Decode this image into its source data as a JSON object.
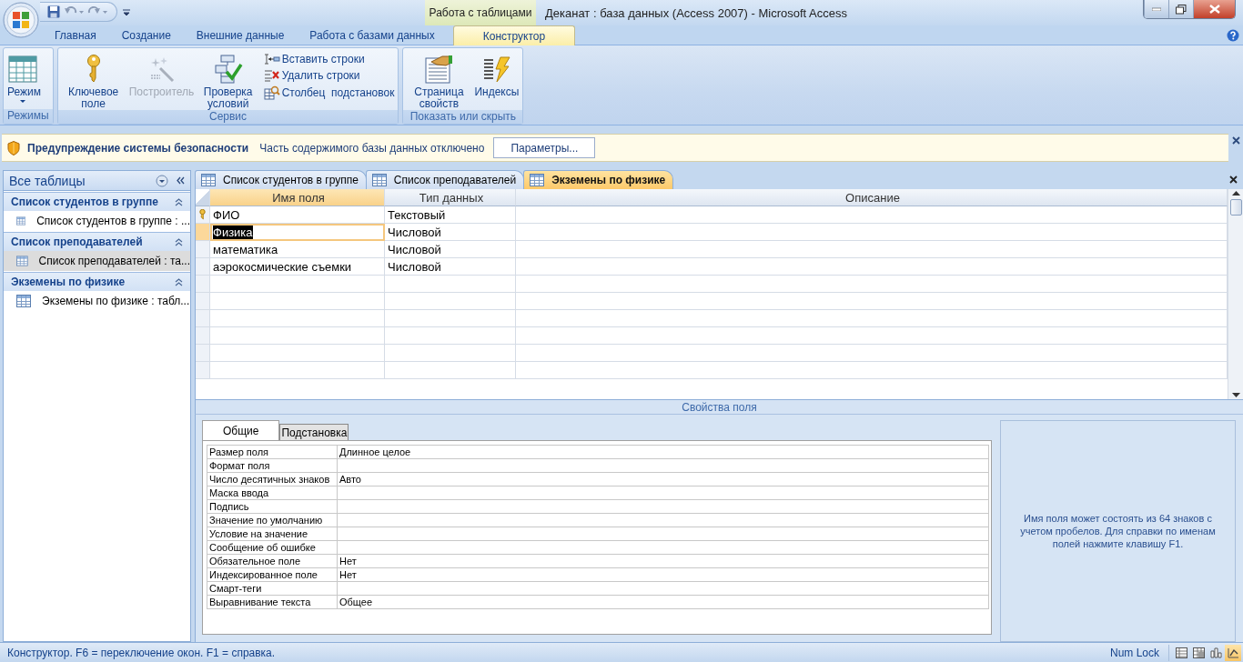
{
  "window": {
    "context_tab": "Работа с таблицами",
    "title": "Деканат : база данных (Access 2007)  -  Microsoft Access"
  },
  "ribbon": {
    "tabs": [
      {
        "label": "Главная",
        "selected": false
      },
      {
        "label": "Создание",
        "selected": false
      },
      {
        "label": "Внешние данные",
        "selected": false
      },
      {
        "label": "Работа с базами данных",
        "selected": false
      },
      {
        "label": "Конструктор",
        "selected": true
      }
    ],
    "groups": [
      {
        "label": "Режимы",
        "items": [
          {
            "kind": "large",
            "label": "Режим",
            "disabled": false
          }
        ]
      },
      {
        "label": "Сервис",
        "items": [
          {
            "kind": "large",
            "label": "Ключевое поле",
            "disabled": false
          },
          {
            "kind": "large",
            "label": "Построитель",
            "disabled": true
          },
          {
            "kind": "large",
            "label": "Проверка условий",
            "disabled": false
          },
          {
            "kind": "small",
            "label": "Вставить строки",
            "disabled": false
          },
          {
            "kind": "small",
            "label": "Удалить строки",
            "disabled": false
          },
          {
            "kind": "small",
            "label": "Столбец  подстановок",
            "disabled": false
          }
        ]
      },
      {
        "label": "Показать или скрыть",
        "items": [
          {
            "kind": "large",
            "label": "Страница свойств",
            "disabled": false
          },
          {
            "kind": "large",
            "label": "Индексы",
            "disabled": false
          }
        ]
      }
    ]
  },
  "security_bar": {
    "title": "Предупреждение системы безопасности",
    "message": "Часть содержимого базы данных отключено",
    "button": "Параметры..."
  },
  "navigation_pane": {
    "title": "Все таблицы",
    "groups": [
      {
        "label": "Список студентов в группе",
        "items": [
          {
            "label": "Список студентов в группе : ...",
            "selected": false
          }
        ]
      },
      {
        "label": "Список преподавателей",
        "items": [
          {
            "label": "Список преподавателей : та...",
            "selected": true
          }
        ]
      },
      {
        "label": "Экземены по физике",
        "items": [
          {
            "label": "Экземены по физике : табл...",
            "selected": false
          }
        ]
      }
    ]
  },
  "document_tabs": [
    {
      "label": "Список студентов в группе",
      "selected": false
    },
    {
      "label": "Список преподавателей",
      "selected": false
    },
    {
      "label": "Экземены по физике",
      "selected": true
    }
  ],
  "design_grid": {
    "columns": [
      "Имя поля",
      "Тип данных",
      "Описание"
    ],
    "rows": [
      {
        "name": "ФИО",
        "type": "Текстовый",
        "primary_key": true,
        "selected": false
      },
      {
        "name": "Физика",
        "type": "Числовой",
        "primary_key": false,
        "selected": true
      },
      {
        "name": "математика",
        "type": "Числовой",
        "primary_key": false,
        "selected": false
      },
      {
        "name": "аэрокосмические съемки",
        "type": "Числовой",
        "primary_key": false,
        "selected": false
      }
    ]
  },
  "field_properties": {
    "caption": "Свойства поля",
    "tabs": [
      {
        "label": "Общие",
        "selected": true
      },
      {
        "label": "Подстановка",
        "selected": false
      }
    ],
    "properties": [
      {
        "label": "Размер поля",
        "value": "Длинное целое"
      },
      {
        "label": "Формат поля"
      },
      {
        "label": "Число десятичных знаков",
        "value": "Авто"
      },
      {
        "label": "Маска ввода"
      },
      {
        "label": "Подпись"
      },
      {
        "label": "Значение по умолчанию"
      },
      {
        "label": "Условие на значение"
      },
      {
        "label": "Сообщение об ошибке"
      },
      {
        "label": "Обязательное поле",
        "value": "Нет"
      },
      {
        "label": "Индексированное поле",
        "value": "Нет"
      },
      {
        "label": "Смарт-теги"
      },
      {
        "label": "Выравнивание текста",
        "value": "Общее"
      }
    ],
    "help": "Имя поля может состоять из 64 знаков с учетом пробелов.  Для справки по именам полей нажмите клавишу F1."
  },
  "status_bar": {
    "text": "Конструктор.  F6 = переключение окон.  F1 = справка.",
    "indicator": "Num Lock",
    "views": [
      {
        "selected": false
      },
      {
        "selected": false
      },
      {
        "selected": false
      },
      {
        "selected": true
      }
    ]
  }
}
